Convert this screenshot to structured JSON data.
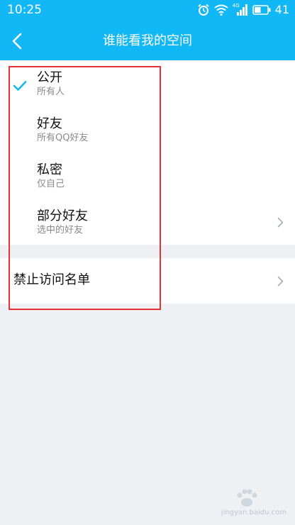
{
  "status_bar": {
    "time": "10:25",
    "network_label": "4G",
    "battery_level": "41"
  },
  "header": {
    "title": "谁能看我的空间"
  },
  "options": [
    {
      "title": "公开",
      "subtitle": "所有人",
      "selected": true,
      "has_chevron": false
    },
    {
      "title": "好友",
      "subtitle": "所有QQ好友",
      "selected": false,
      "has_chevron": false
    },
    {
      "title": "私密",
      "subtitle": "仅自己",
      "selected": false,
      "has_chevron": false
    },
    {
      "title": "部分好友",
      "subtitle": "选中的好友",
      "selected": false,
      "has_chevron": true
    }
  ],
  "blocklist": {
    "label": "禁止访问名单"
  },
  "watermark": {
    "text": "jingyan.baidu.com"
  },
  "colors": {
    "accent": "#12b7f5",
    "highlight": "#e8323a",
    "background": "#eef0f3"
  }
}
